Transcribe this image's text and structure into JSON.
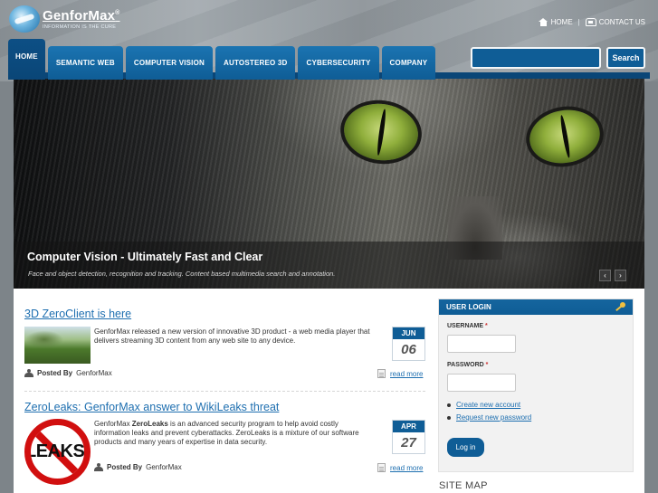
{
  "brand": {
    "name": "GenforMax",
    "registered": "®",
    "tagline": "INFORMATION IS THE CURE"
  },
  "top_links": {
    "home": "HOME",
    "separator": "|",
    "contact": "CONTACT US"
  },
  "nav": {
    "tabs": [
      "HOME",
      "SEMANTIC WEB",
      "COMPUTER VISION",
      "AUTOSTEREO 3D",
      "CYBERSECURITY",
      "COMPANY"
    ],
    "active": "HOME"
  },
  "search": {
    "value": "",
    "button_label": "Search"
  },
  "hero": {
    "title": "Computer Vision - Ultimately Fast and Clear",
    "subtitle": "Face and object detection, recognition and tracking. Content based multimedia search and annotation.",
    "prev": "‹",
    "next": "›"
  },
  "articles": [
    {
      "title": "3D ZeroClient is here",
      "text": "GenforMax released a new version of innovative 3D product - a web media player that delivers streaming 3D content from any web site to any device.",
      "month": "JUN",
      "day": "06",
      "posted_by_label": "Posted By",
      "author": "GenforMax",
      "read_more": "read more"
    },
    {
      "title": "ZeroLeaks: GenforMax answer to WikiLeaks threat",
      "text_before": "GenforMax ",
      "text_bold": "ZeroLeaks",
      "text_after": " is an advanced security program to help avoid costly information leaks and prevent cyberattacks. ZeroLeaks is a mixture of our software products and many years of expertise in data security.",
      "image_label": "LEAKS",
      "month": "APR",
      "day": "27",
      "posted_by_label": "Posted By",
      "author": "GenforMax",
      "read_more": "read more"
    }
  ],
  "login": {
    "title": "USER LOGIN",
    "username_label": "USERNAME",
    "password_label": "PASSWORD",
    "required_mark": "*",
    "username_value": "",
    "password_value": "",
    "create_account": "Create new account",
    "request_password": "Request new password",
    "button": "Log in"
  },
  "sitemap": {
    "title": "SITE MAP"
  },
  "colors": {
    "accent": "#0f5d96",
    "link": "#1e6fb0",
    "required": "#cc3333",
    "leaks_red": "#d10f0f"
  }
}
